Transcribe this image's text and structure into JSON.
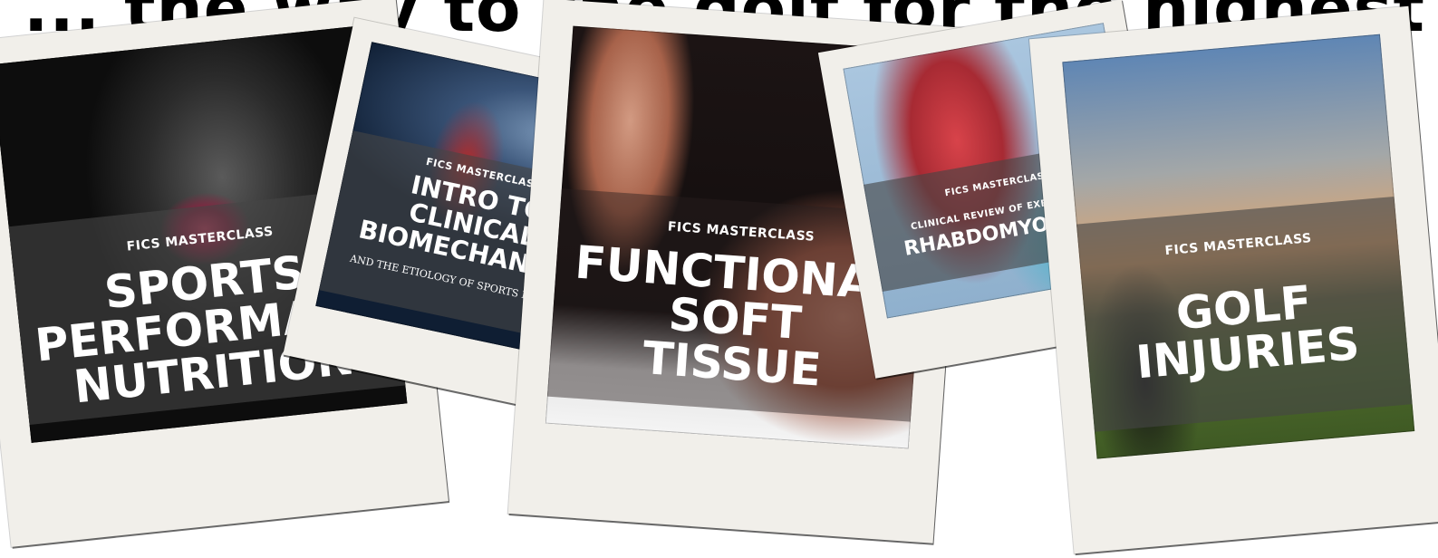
{
  "page": {
    "headline": "... the way to the golf for the highest tag..."
  },
  "cards": [
    {
      "tag": "FICS MASTERCLASS",
      "title_lines": [
        "SPORTS",
        "PERFORMANCE",
        "NUTRITION"
      ],
      "subtitle": ""
    },
    {
      "tag": "FICS MASTERCLASS",
      "title_lines": [
        "INTRO TO",
        "CLINICAL",
        "BIOMECHANICS"
      ],
      "subtitle": "AND THE ETIOLOGY OF SPORTS INJURIES"
    },
    {
      "tag": "FICS MASTERCLASS",
      "title_lines": [
        "FUNCTIONAL",
        "SOFT",
        "TISSUE"
      ],
      "subtitle": ""
    },
    {
      "tag": "FICS MASTERCLASS",
      "pretitle": "CLINICAL REVIEW OF EXERTIONAL",
      "title_lines": [
        "RHABDOMYOLYSIS"
      ],
      "subtitle": ""
    },
    {
      "tag": "FICS MASTERCLASS",
      "title_lines": [
        "GOLF",
        "INJURIES"
      ],
      "subtitle": ""
    }
  ],
  "colors": {
    "polaroid_frame": "#f1efea",
    "band_overlay": "rgba(70,70,70,0.62)",
    "text": "#ffffff"
  }
}
